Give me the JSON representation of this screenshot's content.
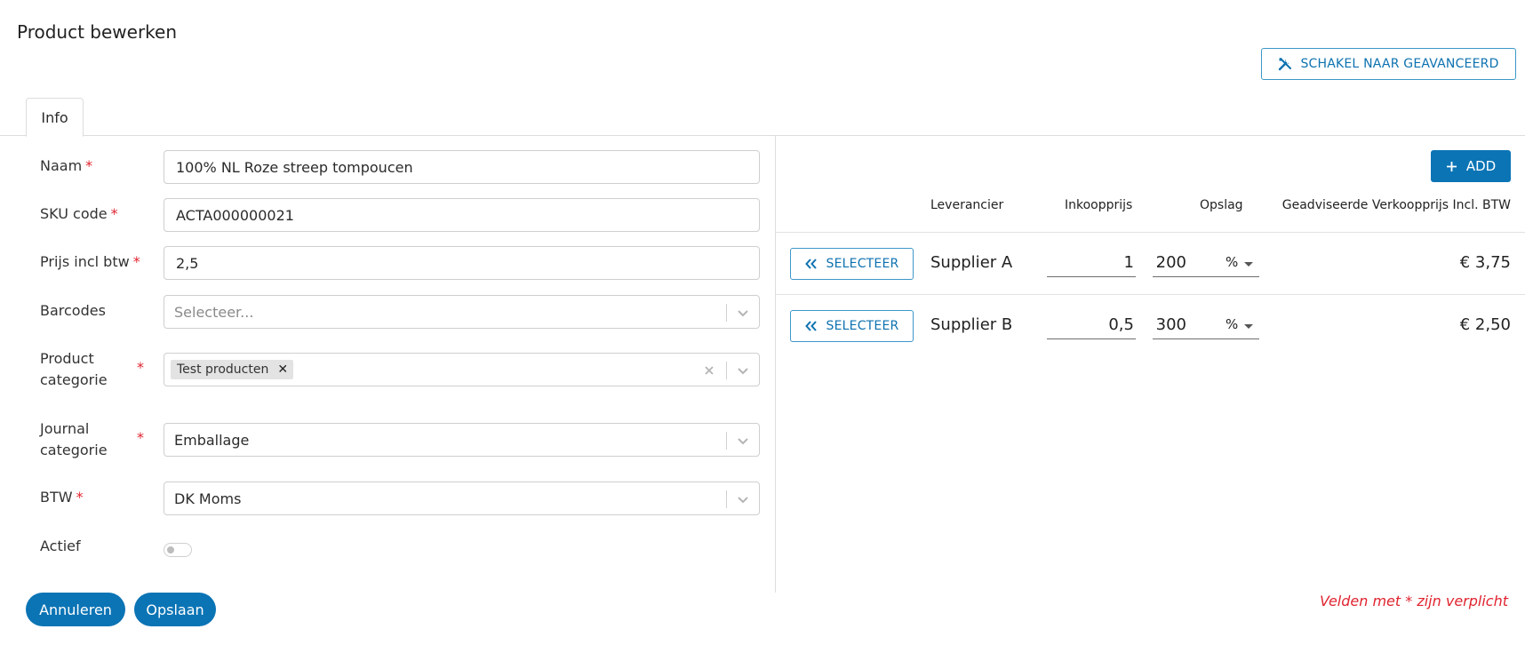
{
  "page": {
    "title": "Product bewerken",
    "advanced_button": "SCHAKEL NAAR GEAVANCEERD",
    "tab_info": "Info"
  },
  "form": {
    "naam": {
      "label": "Naam",
      "value": "100% NL Roze streep tompoucen"
    },
    "sku": {
      "label": "SKU code",
      "value": "ACTA000000021"
    },
    "prijs": {
      "label": "Prijs incl btw",
      "value": "2,5"
    },
    "barcodes": {
      "label": "Barcodes",
      "placeholder": "Selecteer..."
    },
    "product_categorie": {
      "label_line1": "Product",
      "label_line2": "categorie",
      "chip": "Test producten"
    },
    "journal_categorie": {
      "label_line1": "Journal",
      "label_line2": "categorie",
      "value": "Emballage"
    },
    "btw": {
      "label": "BTW",
      "value": "DK Moms"
    },
    "actief": {
      "label": "Actief",
      "checked": false
    },
    "required_mark": "*"
  },
  "suppliers": {
    "add_button": "ADD",
    "headers": {
      "leverancier": "Leverancier",
      "inkoopprijs": "Inkoopprijs",
      "opslag": "Opslag",
      "verkoopprijs": "Geadviseerde Verkoopprijs Incl. BTW"
    },
    "select_label": "SELECTEER",
    "rows": [
      {
        "name": "Supplier A",
        "inkoopprijs": "1",
        "opslag": "200",
        "unit": "%",
        "price": "€ 3,75"
      },
      {
        "name": "Supplier B",
        "inkoopprijs": "0,5",
        "opslag": "300",
        "unit": "%",
        "price": "€ 2,50"
      }
    ]
  },
  "footer": {
    "cancel": "Annuleren",
    "save": "Opslaan",
    "required_note": "Velden met * zijn verplicht"
  },
  "colors": {
    "primary": "#0b74b5",
    "required": "#e0242f"
  }
}
